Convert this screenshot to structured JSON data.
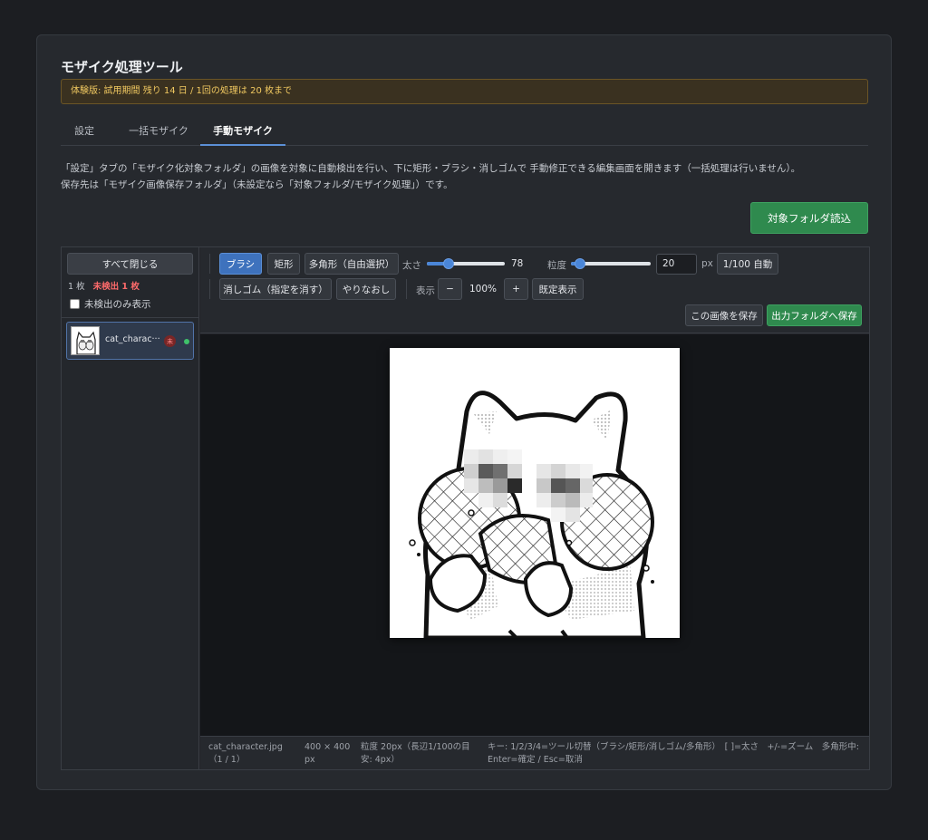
{
  "app": {
    "title": "モザイク処理ツール",
    "trial_notice": "体験版: 試用期間 残り 14 日 / 1回の処理は 20 枚まで"
  },
  "tabs": [
    {
      "label": "設定",
      "active": false
    },
    {
      "label": "一括モザイク",
      "active": false
    },
    {
      "label": "手動モザイク",
      "active": true
    }
  ],
  "description": {
    "line1": "「設定」タブの「モザイク化対象フォルダ」の画像を対象に自動検出を行い、下に矩形・ブラシ・消しゴムで 手動修正できる編集画面を開きます（一括処理は行いません）。",
    "line2": "保存先は「モザイク画像保存フォルダ」（未設定なら「対象フォルダ/モザイク処理」）です。"
  },
  "actions": {
    "load_button": "対象フォルダ読込"
  },
  "sidebar": {
    "close_all": "すべて閉じる",
    "count": "1 枚",
    "undetected": "未検出 1 枚",
    "filter_label": "未検出のみ表示",
    "filter_checked": false,
    "files": [
      {
        "name": "cat_charac···",
        "badge": "未",
        "status_color": "#3fc26a"
      }
    ]
  },
  "toolbar": {
    "tools": {
      "brush": "ブラシ",
      "rect": "矩形",
      "polygon": "多角形（自由選択）"
    },
    "active_tool": "brush",
    "size_label": "太さ",
    "size_value": "78",
    "size_fraction": 0.28,
    "grain_label": "粒度",
    "grain_fraction": 0.11,
    "grain_input": "20",
    "grain_unit": "px",
    "auto_button": "1/100 自動",
    "eraser": "消しゴム（指定を消す）",
    "redo": "やりなおし",
    "view_label": "表示",
    "zoom_out": "−",
    "zoom_value": "100%",
    "zoom_in": "+",
    "reset_view": "既定表示",
    "save_image": "この画像を保存",
    "save_output": "出力フォルダへ保存"
  },
  "status": {
    "file": "cat_character.jpg（1 / 1）",
    "size": "400 × 400 px",
    "grain": "粒度 20px（長辺1/100の目安: 4px）",
    "keys": "キー: 1/2/3/4=ツール切替（ブラシ/矩形/消しゴム/多角形）　[ ]=太さ　+/-=ズーム　多角形中: Enter=確定 / Esc=取消"
  },
  "colors": {
    "accent_blue": "#3e72bd",
    "accent_green": "#2f8a4e",
    "warning_text": "#f0c860",
    "undetected_red": "#ff6b6b"
  },
  "icons": [
    "cat-thumbnail-icon",
    "status-dot-icon",
    "undetected-badge-icon"
  ]
}
